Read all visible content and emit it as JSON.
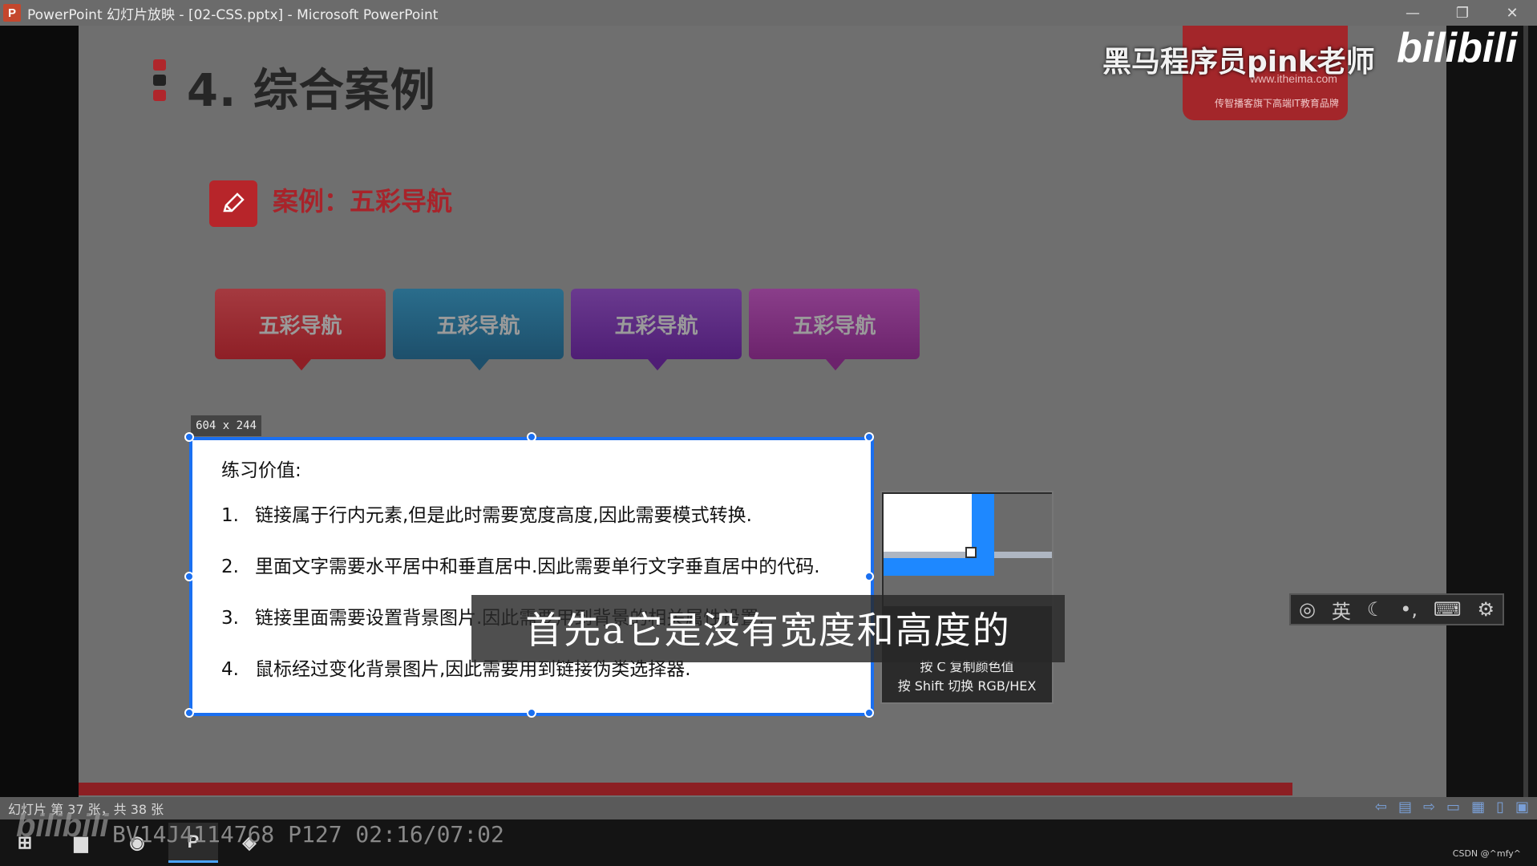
{
  "window": {
    "app_icon": "P",
    "title": "PowerPoint 幻灯片放映 - [02-CSS.pptx] - Microsoft PowerPoint",
    "controls": [
      "—",
      "❐",
      "✕"
    ]
  },
  "slide": {
    "title": "4. 综合案例",
    "case_title": "案例：五彩导航",
    "nav_buttons": [
      "五彩导航",
      "五彩导航",
      "五彩导航",
      "五彩导航"
    ],
    "logo_site": "www.itheima.com",
    "logo_slogan": "传智播客旗下高端IT教育品牌"
  },
  "watermark": {
    "text": "黑马程序员pink老师",
    "brand": "bilibili"
  },
  "selection": {
    "dimension_label": "604 x 244",
    "heading": "练习价值:",
    "items": [
      {
        "num": "1.",
        "text": "链接属于行内元素,但是此时需要宽度高度,因此需要模式转换."
      },
      {
        "num": "2.",
        "text": "里面文字需要水平居中和垂直居中.因此需要单行文字垂直居中的代码."
      },
      {
        "num": "3.",
        "text": "链接里面需要设置背景图片.因此需要用到背景的相关属性设置."
      },
      {
        "num": "4.",
        "text": "鼠标经过变化背景图片,因此需要用到链接伪类选择器."
      }
    ]
  },
  "color_picker": {
    "hint_copy": "按 C 复制颜色值",
    "hint_toggle": "按 Shift 切换 RGB/HEX"
  },
  "subtitle": "首先a它是没有宽度和高度的",
  "ime_toolbar": {
    "lang": "英"
  },
  "statusbar": {
    "slide_info": "幻灯片 第 37 张，共 38 张"
  },
  "taskbar": {
    "video_info": "BV14J4114768  P127  02:16/07:02",
    "credit": "CSDN @^mfy^"
  },
  "colors": {
    "accent_red": "#b7252a",
    "selection_blue": "#1a6ff0",
    "nav_red": "#a53a40",
    "nav_blue": "#2a6d8c",
    "nav_purple": "#6a3a8f",
    "nav_magenta": "#8a3e8a"
  }
}
